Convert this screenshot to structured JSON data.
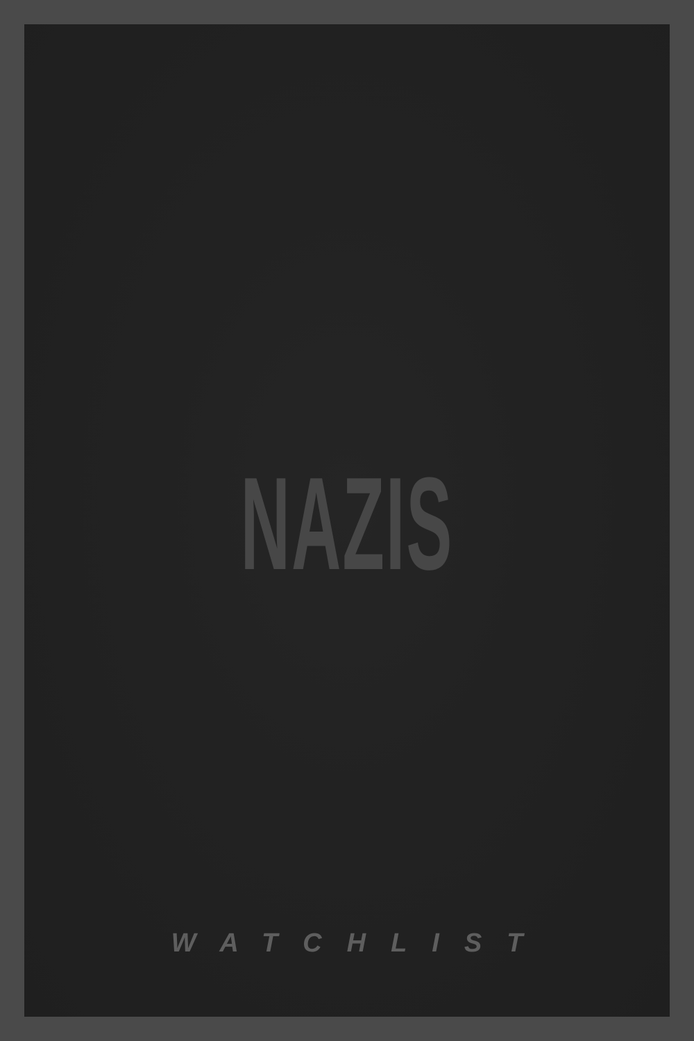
{
  "poster": {
    "title": "NAZIS",
    "footer": "WATCHLIST"
  },
  "colors": {
    "frame": "#4a4a4a",
    "background": "#212121",
    "title_text": "#474747",
    "footer_text": "#5e5e5e"
  }
}
